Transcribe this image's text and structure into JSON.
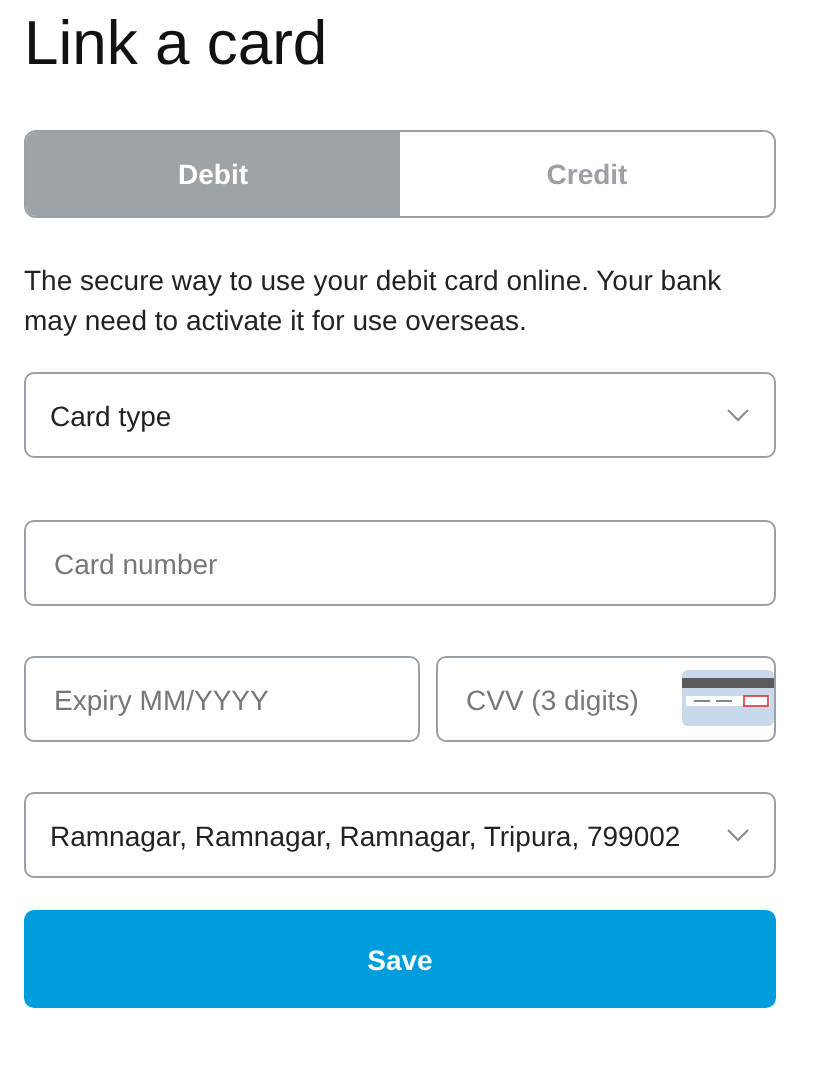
{
  "title": "Link a card",
  "tabs": [
    {
      "label": "Debit",
      "selected": true
    },
    {
      "label": "Credit",
      "selected": false
    }
  ],
  "description": "The secure way to use your debit card online. Your bank may need to activate it for use overseas.",
  "card_type": {
    "placeholder": "Card type"
  },
  "card_number": {
    "placeholder": "Card number"
  },
  "expiry": {
    "placeholder": "Expiry MM/YYYY"
  },
  "cvv": {
    "placeholder": "CVV (3 digits)"
  },
  "address": {
    "value": "Ramnagar, Ramnagar, Ramnagar, Tripura, 799002"
  },
  "save_button": "Save"
}
